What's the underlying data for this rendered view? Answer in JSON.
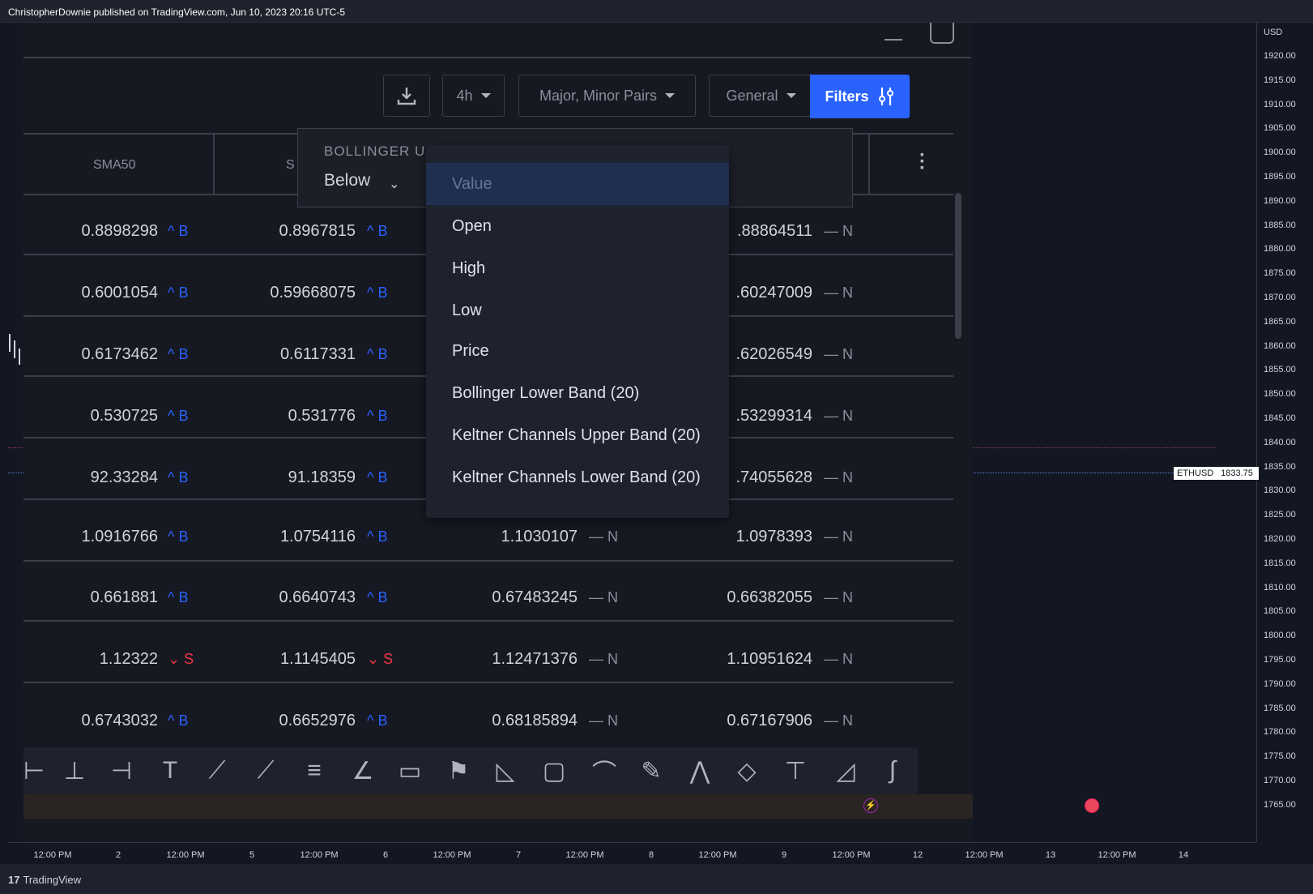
{
  "header": {
    "attribution": "ChristopherDownie published on TradingView.com, Jun 10, 2023 20:16 UTC-5"
  },
  "price_axis": {
    "currency": "USD",
    "ticks": [
      "1920.00",
      "1915.00",
      "1910.00",
      "1905.00",
      "1900.00",
      "1895.00",
      "1890.00",
      "1885.00",
      "1880.00",
      "1875.00",
      "1870.00",
      "1865.00",
      "1860.00",
      "1855.00",
      "1850.00",
      "1845.00",
      "1840.00",
      "1835.00",
      "1830.00",
      "1825.00",
      "1820.00",
      "1815.00",
      "1810.00",
      "1805.00",
      "1800.00",
      "1795.00",
      "1790.00",
      "1785.00",
      "1780.00",
      "1775.00",
      "1770.00",
      "1765.00"
    ],
    "symbol_tag": "ETHUSD",
    "price_tag": "1833.75"
  },
  "time_axis": [
    "12:00 PM",
    "2",
    "12:00 PM",
    "5",
    "12:00 PM",
    "6",
    "12:00 PM",
    "7",
    "12:00 PM",
    "8",
    "12:00 PM",
    "9",
    "12:00 PM",
    "12",
    "12:00 PM",
    "13",
    "12:00 PM",
    "14"
  ],
  "footer": {
    "logo_mark": "17",
    "logo_text": "TradingView"
  },
  "screener": {
    "toolbar": {
      "timeframe": "4h",
      "market": "Major, Minor Pairs",
      "view": "General",
      "filters": "Filters"
    },
    "columns": [
      "SMA50",
      "S"
    ],
    "rows": [
      {
        "c1": "0.8898298",
        "s1": "^ B",
        "c2": "0.8967815",
        "s2": "^ B",
        "c3": "",
        "s3": "",
        "c4": ".88864511",
        "s4": "— N"
      },
      {
        "c1": "0.6001054",
        "s1": "^ B",
        "c2": "0.59668075",
        "s2": "^ B",
        "c3": "",
        "s3": "",
        "c4": ".60247009",
        "s4": "— N"
      },
      {
        "c1": "0.6173462",
        "s1": "^ B",
        "c2": "0.6117331",
        "s2": "^ B",
        "c3": "",
        "s3": "",
        "c4": ".62026549",
        "s4": "— N"
      },
      {
        "c1": "0.530725",
        "s1": "^ B",
        "c2": "0.531776",
        "s2": "^ B",
        "c3": "",
        "s3": "",
        "c4": ".53299314",
        "s4": "— N"
      },
      {
        "c1": "92.33284",
        "s1": "^ B",
        "c2": "91.18359",
        "s2": "^ B",
        "c3": "",
        "s3": "",
        "c4": ".74055628",
        "s4": "— N"
      },
      {
        "c1": "1.0916766",
        "s1": "^ B",
        "c2": "1.0754116",
        "s2": "^ B",
        "c3": "1.1030107",
        "s3": "— N",
        "c4": "1.0978393",
        "s4": "— N"
      },
      {
        "c1": "0.661881",
        "s1": "^ B",
        "c2": "0.6640743",
        "s2": "^ B",
        "c3": "0.67483245",
        "s3": "— N",
        "c4": "0.66382055",
        "s4": "— N"
      },
      {
        "c1": "1.12322",
        "s1": "⌄ S",
        "c2": "1.1145405",
        "s2": "⌄ S",
        "c3": "1.12471376",
        "s3": "— N",
        "c4": "1.10951624",
        "s4": "— N"
      },
      {
        "c1": "0.6743032",
        "s1": "^ B",
        "c2": "0.6652976",
        "s2": "^ B",
        "c3": "0.68185894",
        "s3": "— N",
        "c4": "0.67167906",
        "s4": "— N"
      }
    ],
    "filter_popup": {
      "title": "BOLLINGER UI",
      "condition": "Below"
    },
    "dropdown": {
      "placeholder": "Value",
      "options": [
        "Open",
        "High",
        "Low",
        "Price",
        "Bollinger Lower Band (20)",
        "Keltner Channels Upper Band (20)",
        "Keltner Channels Lower Band (20)"
      ]
    }
  },
  "drawing_tools": [
    "arrow-icon",
    "cross-line-icon",
    "date-range-icon",
    "text-icon",
    "trend-line-icon",
    "ray-icon",
    "parallel-channel-icon",
    "pitchfork-icon",
    "rectangle-icon",
    "flag-icon",
    "triangle-icon",
    "callout-icon",
    "curve-icon",
    "brush-icon",
    "path-icon",
    "polyline-icon",
    "signpost-icon",
    "angle-icon",
    "arc-icon"
  ]
}
